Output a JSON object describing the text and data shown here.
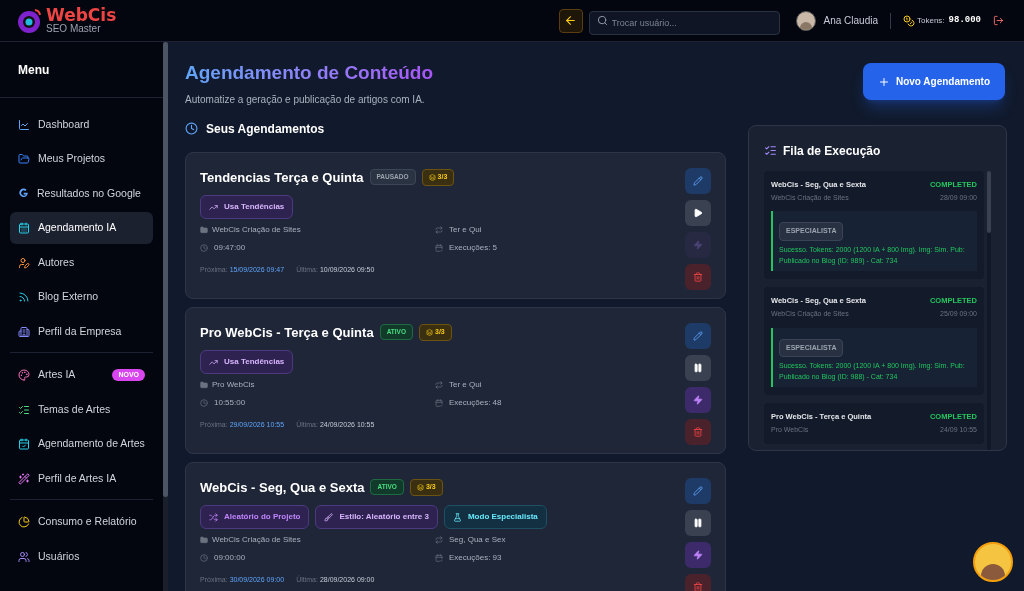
{
  "header": {
    "logo_title": "WebCis",
    "logo_subtitle": "SEO Master",
    "search": {
      "placeholder": "Trocar usuário..."
    },
    "user_name": "Ana Claudia",
    "tokens_label": "Tokens:",
    "tokens_value": "98.000"
  },
  "sidebar": {
    "title": "Menu",
    "groups": [
      [
        {
          "label": "Dashboard",
          "selected": false
        },
        {
          "label": "Meus Projetos",
          "selected": false
        },
        {
          "label": "Resultados no Google",
          "selected": false
        },
        {
          "label": "Agendamento IA",
          "selected": true
        },
        {
          "label": "Autores",
          "selected": false
        },
        {
          "label": "Blog Externo",
          "selected": false
        },
        {
          "label": "Perfil da Empresa",
          "selected": false
        }
      ],
      [
        {
          "label": "Artes IA",
          "selected": false,
          "badge": "NOVO"
        },
        {
          "label": "Temas de Artes",
          "selected": false
        },
        {
          "label": "Agendamento de Artes",
          "selected": false
        },
        {
          "label": "Perfil de Artes IA",
          "selected": false
        }
      ],
      [
        {
          "label": "Consumo e Relatório",
          "selected": false
        },
        {
          "label": "Usuários",
          "selected": false
        }
      ]
    ]
  },
  "page": {
    "title": "Agendamento de Conteúdo",
    "subtitle": "Automatize a geração e publicação de artigos com IA.",
    "new_button": "Novo Agendamento"
  },
  "schedules_title": "Seus Agendamentos",
  "schedules": [
    {
      "title": "Tendencias Terça e Quinta",
      "status": {
        "label": "PAUSADO",
        "kind": "paused"
      },
      "quota": "3/3",
      "tags": [
        {
          "kind": "trend",
          "label": "Usa Tendências"
        }
      ],
      "project": "WebCis Criação de Sites",
      "time": "09:47:00",
      "days": "Ter e Qui",
      "runs": "Execuções: 5",
      "next_label": "Próxima:",
      "next": "15/09/2026 09:47",
      "last_label": "Última:",
      "last": "10/09/2026 09:50"
    },
    {
      "title": "Pro WebCis - Terça e Quinta",
      "status": {
        "label": "ATIVO",
        "kind": "active"
      },
      "quota": "3/3",
      "tags": [
        {
          "kind": "trend",
          "label": "Usa Tendências"
        }
      ],
      "project": "Pro WebCis",
      "time": "10:55:00",
      "days": "Ter e Qui",
      "runs": "Execuções: 48",
      "next_label": "Próxima:",
      "next": "29/09/2026 10:55",
      "last_label": "Última:",
      "last": "24/09/2026 10:55"
    },
    {
      "title": "WebCis - Seg, Qua e Sexta",
      "status": {
        "label": "ATIVO",
        "kind": "active"
      },
      "quota": "3/3",
      "tags": [
        {
          "kind": "random",
          "label": "Aleatório do Projeto"
        },
        {
          "kind": "style",
          "label": "Estilo: Aleatório entre 3"
        },
        {
          "kind": "expert",
          "label": "Modo Especialista"
        }
      ],
      "project": "WebCis Criação de Sites",
      "time": "09:00:00",
      "days": "Seg, Qua e Sex",
      "runs": "Execuções: 93",
      "next_label": "Próxima:",
      "next": "30/09/2026 09:00",
      "last_label": "Última:",
      "last": "28/09/2026 09:00"
    }
  ],
  "queue": {
    "title": "Fila de Execução",
    "items": [
      {
        "title": "WebCis - Seg, Qua e Sexta",
        "status": "COMPLETED",
        "project": "WebCis Criação de Sites",
        "date": "28/09 09:00",
        "tag": "ESPECIALISTA",
        "message": "Sucesso. Tokens: 2000 (1200 IA + 800 Img). Img: Sim. Pub: Publicado no Blog (ID: 989) - Cat: 734"
      },
      {
        "title": "WebCis - Seg, Qua e Sexta",
        "status": "COMPLETED",
        "project": "WebCis Criação de Sites",
        "date": "25/09 09:00",
        "tag": "ESPECIALISTA",
        "message": "Sucesso. Tokens: 2000 (1200 IA + 800 Img). Img: Sim. Pub: Publicado no Blog (ID: 988) - Cat: 734"
      },
      {
        "title": "Pro WebCis - Terça e Quinta",
        "status": "COMPLETED",
        "project": "Pro WebCis",
        "date": "24/09 10:55"
      }
    ]
  }
}
